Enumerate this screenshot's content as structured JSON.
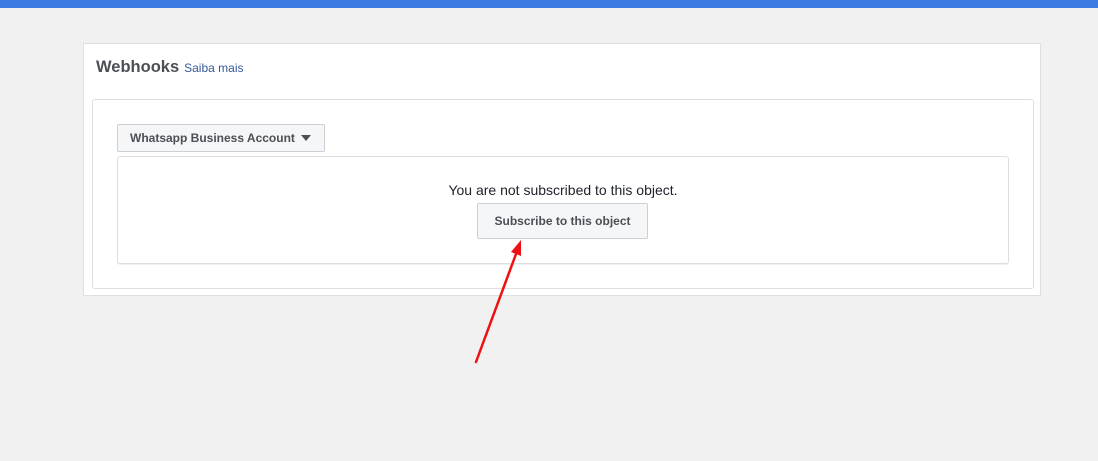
{
  "colors": {
    "top_bar": "#3b7be1",
    "link": "#365899",
    "annotation_arrow": "#ee1111"
  },
  "webhooks": {
    "title": "Webhooks",
    "learn_more": "Saiba mais",
    "object_selector": {
      "selected": "Whatsapp Business Account",
      "icon": "caret-down-icon"
    },
    "status_text": "You are not subscribed to this object.",
    "subscribe_label": "Subscribe to this object"
  }
}
